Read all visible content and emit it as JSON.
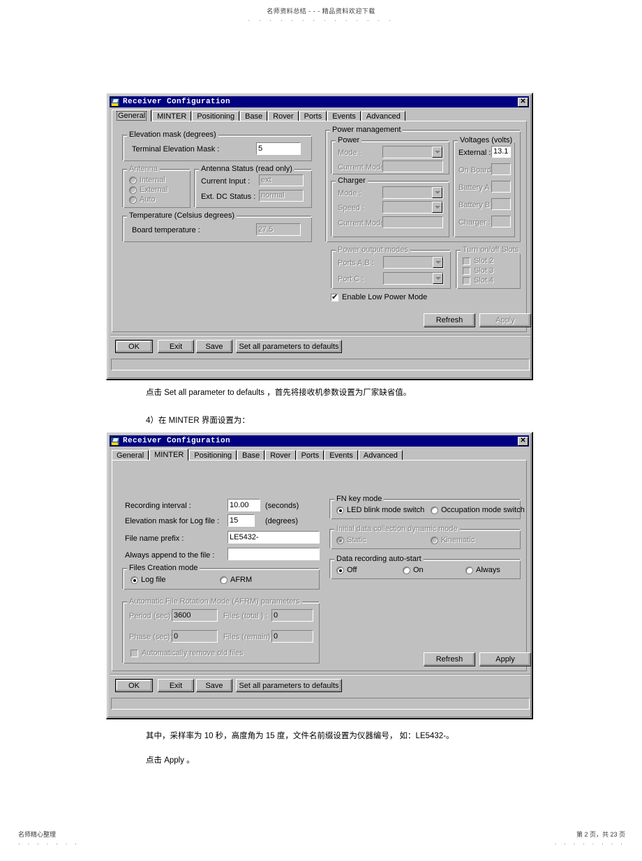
{
  "page": {
    "header_text": "名师资料总结 - - - 精品资料欢迎下载",
    "header_dots": "· · · · · · · · · · · · · ·",
    "footer_left": "名师精心整理",
    "footer_left_dots": "· · · · · · ·",
    "footer_right": "第 2 页，共 23 页",
    "footer_right_dots": "· · · · · · · ·"
  },
  "paragraphs": {
    "p1": "点击 Set all parameter to defaults ，首先将接收机参数设置为厂家缺省值。",
    "p2": "4）在 MINTER  界面设置为：",
    "p3": "其中，采样率为 10 秒，高度角为 15 度，文件名前缀设置为仪器编号，  如：LE5432-。",
    "p4": "点击 Apply 。"
  },
  "dialog1": {
    "title": "Receiver Configuration",
    "icon": "app-icon",
    "close_label": "✕",
    "tabs": [
      {
        "label": "General",
        "selected": true
      },
      {
        "label": "MINTER",
        "selected": false
      },
      {
        "label": "Positioning",
        "selected": false
      },
      {
        "label": "Base",
        "selected": false
      },
      {
        "label": "Rover",
        "selected": false
      },
      {
        "label": "Ports",
        "selected": false
      },
      {
        "label": "Events",
        "selected": false
      },
      {
        "label": "Advanced",
        "selected": false
      }
    ],
    "elevation_group": {
      "title": "Elevation mask (degrees)",
      "terminal_label": "Terminal Elevation Mask :",
      "terminal_value": "5"
    },
    "antenna_group": {
      "title": "Antenna",
      "options": [
        {
          "label": "Internal",
          "selected": false
        },
        {
          "label": "External",
          "selected": false
        },
        {
          "label": "Auto",
          "selected": false
        }
      ]
    },
    "antenna_status_group": {
      "title": "Antenna Status (read only)",
      "current_input_label": "Current Input :",
      "current_input_value": "ext",
      "ext_dc_label": "Ext. DC Status :",
      "ext_dc_value": "normal"
    },
    "temperature_group": {
      "title": "Temperature (Celsius degrees)",
      "board_label": "Board temperature :",
      "board_value": "27.5"
    },
    "power_management": {
      "title": "Power management",
      "power": {
        "title": "Power",
        "mode_label": "Mode :",
        "mode_value": "",
        "current_mode_label": "Current Mode :",
        "current_mode_value": ""
      },
      "charger": {
        "title": "Charger",
        "mode_label": "Mode :",
        "mode_value": "",
        "speed_label": "Speed :",
        "speed_value": "",
        "current_mode_label": "Current Mode :",
        "current_mode_value": ""
      },
      "voltages": {
        "title": "Voltages (volts)",
        "rows": [
          {
            "label": "External :",
            "value": "13.1",
            "enabled": true
          },
          {
            "label": "On Board :",
            "value": "",
            "enabled": false
          },
          {
            "label": "Battery A :",
            "value": "",
            "enabled": false
          },
          {
            "label": "Battery B :",
            "value": "",
            "enabled": false
          },
          {
            "label": "Charger :",
            "value": "",
            "enabled": false
          }
        ]
      }
    },
    "power_output_modes": {
      "title": "Power output modes",
      "ports_ab_label": "Ports A,B :",
      "ports_ab_value": "",
      "port_c_label": "Port C :",
      "port_c_value": ""
    },
    "slots": {
      "title": "Turn on/off Slots",
      "items": [
        {
          "label": "Slot 2",
          "checked": false
        },
        {
          "label": "Slot 3",
          "checked": false
        },
        {
          "label": "Slot 4",
          "checked": false
        }
      ]
    },
    "low_power": {
      "label": "Enable Low Power Mode",
      "checked": true
    },
    "refresh_label": "Refresh",
    "apply_label": "Apply",
    "apply_enabled": false,
    "ok_label": "OK",
    "exit_label": "Exit",
    "save_label": "Save",
    "defaults_label": "Set all parameters to defaults"
  },
  "dialog2": {
    "title": "Receiver Configuration",
    "icon": "app-icon",
    "close_label": "✕",
    "tabs": [
      {
        "label": "General",
        "selected": false
      },
      {
        "label": "MINTER",
        "selected": true
      },
      {
        "label": "Positioning",
        "selected": false
      },
      {
        "label": "Base",
        "selected": false
      },
      {
        "label": "Rover",
        "selected": false
      },
      {
        "label": "Ports",
        "selected": false
      },
      {
        "label": "Events",
        "selected": false
      },
      {
        "label": "Advanced",
        "selected": false
      }
    ],
    "recording_interval": {
      "label": "Recording interval :",
      "value": "10.00",
      "units": "(seconds)"
    },
    "elevation_mask": {
      "label": "Elevation mask for Log file :",
      "value": "15",
      "units": "(degrees)"
    },
    "file_prefix": {
      "label": "File name prefix :",
      "value": "LE5432-"
    },
    "always_append": {
      "label": "Always append to the file :",
      "value": ""
    },
    "files_creation": {
      "title": "Files Creation mode",
      "options": [
        {
          "label": "Log file",
          "selected": true
        },
        {
          "label": "AFRM",
          "selected": false
        }
      ]
    },
    "afrm": {
      "title": "Automatic File Rotation Mode (AFRM) parameters",
      "period_label": "Period (sec) :",
      "period_value": "3600",
      "files_total_label": "Files (total ) :",
      "files_total_value": "0",
      "phase_label": "Phase (sec):",
      "phase_value": "0",
      "files_remain_label": "Files (remain) :",
      "files_remain_value": "0",
      "auto_remove_label": "Automatically remove old files",
      "auto_remove_checked": false
    },
    "fn_key_mode": {
      "title": "FN key mode",
      "options": [
        {
          "label": "LED blink mode switch",
          "selected": true
        },
        {
          "label": "Occupation mode switch",
          "selected": false
        }
      ]
    },
    "initial_dynamic": {
      "title": "Initial data collection dynamic mode",
      "options": [
        {
          "label": "Static",
          "selected": true
        },
        {
          "label": "Kinematic",
          "selected": false
        }
      ]
    },
    "auto_start": {
      "title": "Data recording auto-start",
      "options": [
        {
          "label": "Off",
          "selected": true
        },
        {
          "label": "On",
          "selected": false
        },
        {
          "label": "Always",
          "selected": false
        }
      ]
    },
    "refresh_label": "Refresh",
    "apply_label": "Apply",
    "apply_enabled": true,
    "ok_label": "OK",
    "exit_label": "Exit",
    "save_label": "Save",
    "defaults_label": "Set all parameters to defaults"
  }
}
